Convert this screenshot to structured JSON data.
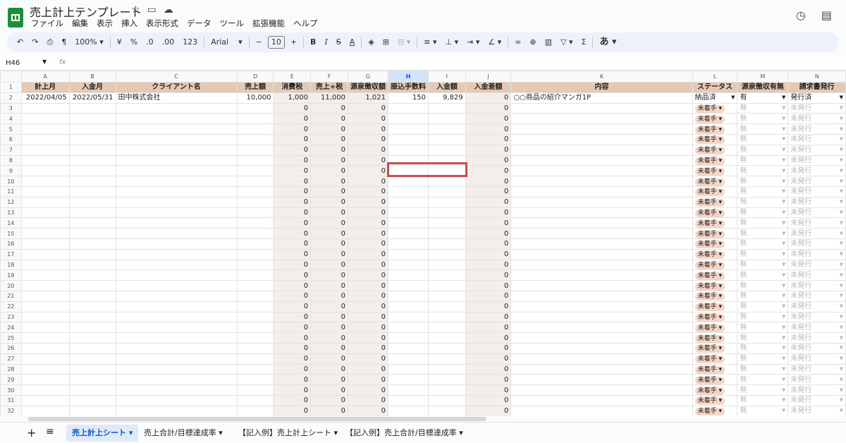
{
  "app": {
    "title": "売上計上テンプレート",
    "menu": [
      "ファイル",
      "編集",
      "表示",
      "挿入",
      "表示形式",
      "データ",
      "ツール",
      "拡張機能",
      "ヘルプ"
    ]
  },
  "toolbar": {
    "zoom": "100%",
    "currency": "¥",
    "percent": "%",
    "dec_minus": ".0",
    "dec_plus": ".00",
    "format123": "123",
    "font": "Arial",
    "font_size": "10",
    "bold": "B",
    "italic": "I",
    "ime": "あ"
  },
  "formula_bar": {
    "cell": "H46",
    "fx": "fx"
  },
  "columns": [
    "A",
    "B",
    "C",
    "D",
    "E",
    "F",
    "G",
    "H",
    "I",
    "J",
    "K",
    "L",
    "M",
    "N"
  ],
  "selected_column": "H",
  "headers": [
    "計上月",
    "入金月",
    "クライアント名",
    "売上額",
    "消費税",
    "売上+税",
    "源泉徴収額",
    "振込手数料",
    "入金額",
    "入金差額",
    "内容",
    "ステータス",
    "源泉徴収有無",
    "請求書発行"
  ],
  "row2": {
    "a": "2022/04/05",
    "b": "2022/05/31",
    "c": "田中株式会社",
    "d": "10,000",
    "e": "1,000",
    "f": "11,000",
    "g": "1,021",
    "h": "150",
    "i": "9,829",
    "j": "0",
    "k": "○○商品の紹介マンガ1P",
    "l": "納品済",
    "m": "有",
    "n": "発行済"
  },
  "empty_rows": {
    "zero": "0",
    "status": "未着手",
    "withholding": "無",
    "invoice": "未発行"
  },
  "row_count": 32,
  "tabs": [
    "売上計上シート",
    "売上合計/目標達成率",
    "【記入例】売上計上シート",
    "【記入例】売上合計/目標達成率"
  ],
  "active_tab": 0,
  "colors": {
    "header_fill": "#e6c9b3",
    "shade": "#f4eeeb",
    "highlight": "#c0504d",
    "chip": "#f4d6c6"
  }
}
